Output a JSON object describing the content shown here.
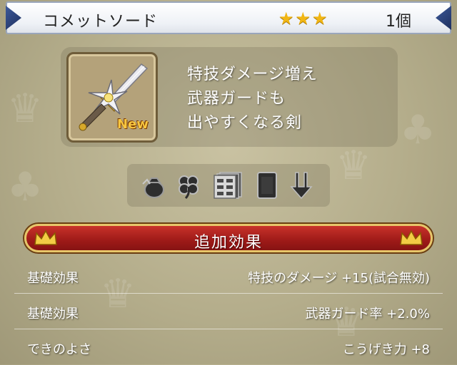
{
  "header": {
    "item_name": "コメットソード",
    "stars": "★★★",
    "count": "1個"
  },
  "item": {
    "icon": "comet-sword-icon",
    "new_badge": "New",
    "description": [
      "特技ダメージ増え",
      "武器ガードも",
      "出やすくなる剣"
    ]
  },
  "categories": [
    "bag-icon",
    "clover-icon",
    "drawer-icon",
    "card-icon",
    "downward-arrows-icon"
  ],
  "effects_section": {
    "title": "追加効果",
    "rows": [
      {
        "label": "基礎効果",
        "value": "特技のダメージ +15(試合無効)"
      },
      {
        "label": "基礎効果",
        "value": "武器ガード率 +2.0%"
      },
      {
        "label": "できのよさ",
        "value": "こうげき力 +8"
      }
    ]
  },
  "colors": {
    "banner_red": "#9e1a18",
    "banner_gold": "#e7c66a",
    "star_gold": "#f1b614"
  }
}
